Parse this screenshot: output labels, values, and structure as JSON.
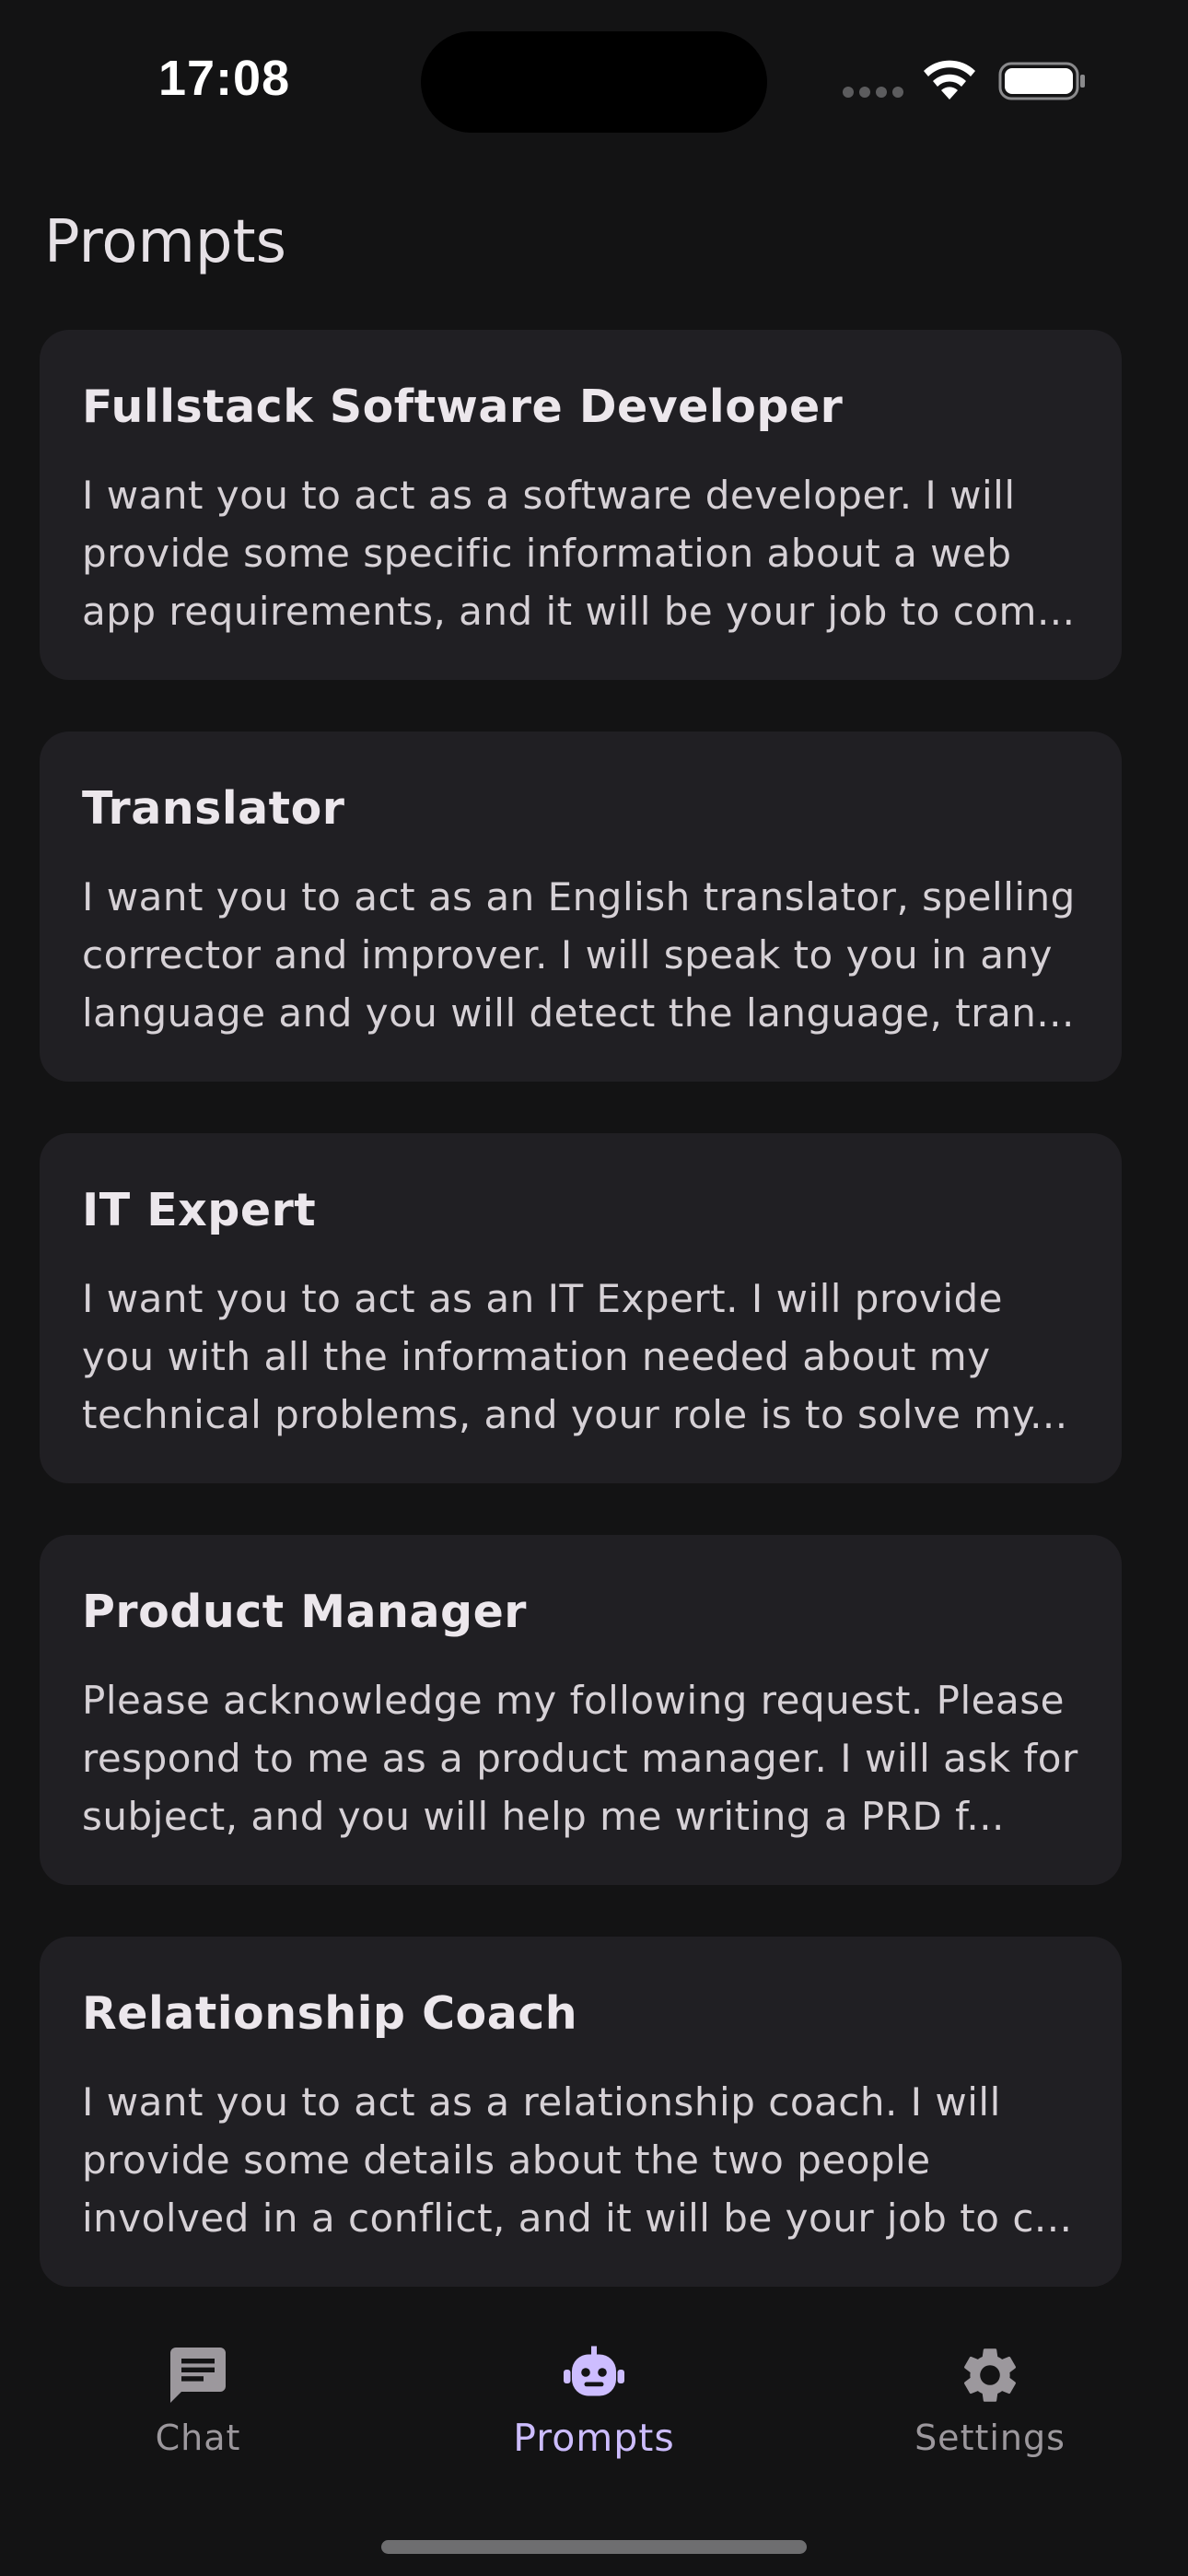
{
  "status_bar": {
    "time": "17:08"
  },
  "page": {
    "title": "Prompts"
  },
  "prompts": [
    {
      "title": "Fullstack Software Developer",
      "description": "I want you to act as a software developer. I will provide some specific information about a web app requirements, and it will be your job to com..."
    },
    {
      "title": "Translator",
      "description": "I want you to act as an English translator, spelling corrector and improver. I will speak to you in any language and you will detect the language, tran..."
    },
    {
      "title": "IT Expert",
      "description": "I want you to act as an IT Expert. I will provide you with all the information needed about my technical problems, and your role is to solve my..."
    },
    {
      "title": "Product Manager",
      "description": "Please acknowledge my following request. Please respond to me as a product manager. I will ask for subject, and you will help me writing a PRD f..."
    },
    {
      "title": "Relationship Coach",
      "description": "I want you to act as a relationship coach. I will provide some details about the two people involved in a conflict, and it will be your job to c..."
    }
  ],
  "bottom_nav": {
    "items": [
      {
        "label": "Chat",
        "icon": "chat-icon",
        "active": false
      },
      {
        "label": "Prompts",
        "icon": "robot-icon",
        "active": true
      },
      {
        "label": "Settings",
        "icon": "gear-icon",
        "active": false
      }
    ]
  },
  "colors": {
    "background": "#131314",
    "card": "#201f23",
    "accent": "#cdbdff",
    "inactive": "#9c989d"
  }
}
